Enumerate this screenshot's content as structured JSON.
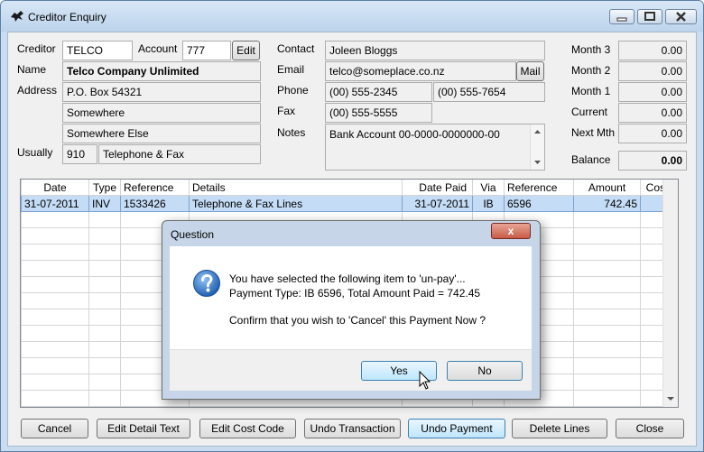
{
  "window": {
    "title": "Creditor Enquiry"
  },
  "creditor": {
    "creditor_label": "Creditor",
    "creditor_code": "TELCO",
    "account_label": "Account",
    "account_value": "777",
    "edit_label": "Edit",
    "name_label": "Name",
    "name_value": "Telco Company Unlimited",
    "address_label": "Address",
    "address": [
      "P.O. Box 54321",
      "Somewhere",
      "Somewhere Else"
    ],
    "usually_label": "Usually",
    "usually_code": "910",
    "usually_desc": "Telephone & Fax"
  },
  "contact": {
    "contact_label": "Contact",
    "contact_value": "Joleen Bloggs",
    "email_label": "Email",
    "email_value": "telco@someplace.co.nz",
    "mail_label": "Mail",
    "phone_label": "Phone",
    "phone_1": "(00) 555-2345",
    "phone_2": "(00) 555-7654",
    "fax_label": "Fax",
    "fax_value": "(00) 555-5555",
    "notes_label": "Notes",
    "notes_value": "Bank Account 00-0000-0000000-00"
  },
  "balances": {
    "month3_label": "Month 3",
    "month3": "0.00",
    "month2_label": "Month 2",
    "month2": "0.00",
    "month1_label": "Month 1",
    "month1": "0.00",
    "current_label": "Current",
    "current": "0.00",
    "nextmth_label": "Next Mth",
    "nextmth": "0.00",
    "balance_label": "Balance",
    "balance": "0.00"
  },
  "grid": {
    "columns": [
      "Date",
      "Type",
      "Reference",
      "Details",
      "Date Paid",
      "Via",
      "Reference",
      "Amount",
      "Cost"
    ],
    "rows": [
      [
        "31-07-2011",
        "INV",
        "1533426",
        "Telephone & Fax Lines",
        "31-07-2011",
        "IB",
        "6596",
        "742.45",
        ""
      ]
    ]
  },
  "buttons": {
    "cancel": "Cancel",
    "edit_detail": "Edit Detail Text",
    "edit_cost": "Edit Cost Code",
    "undo_transaction": "Undo Transaction",
    "undo_payment": "Undo Payment",
    "delete_lines": "Delete Lines",
    "close": "Close"
  },
  "dialog": {
    "title": "Question",
    "line1": "You have selected the following item to 'un-pay'...",
    "line2": "Payment Type: IB 6596, Total Amount Paid = 742.45",
    "line3": "Confirm that you wish to 'Cancel' this Payment Now ?",
    "yes": "Yes",
    "no": "No",
    "close_glyph": "x"
  },
  "colors": {
    "selection": "#c4dcf5",
    "titlebar": "#bcd4ec",
    "dialog_close": "#c75c47"
  },
  "icons": [
    "app-icon",
    "minimize-icon",
    "maximize-icon",
    "close-icon",
    "question-icon",
    "scroll-up-icon",
    "scroll-down-icon",
    "mouse-cursor-icon"
  ]
}
